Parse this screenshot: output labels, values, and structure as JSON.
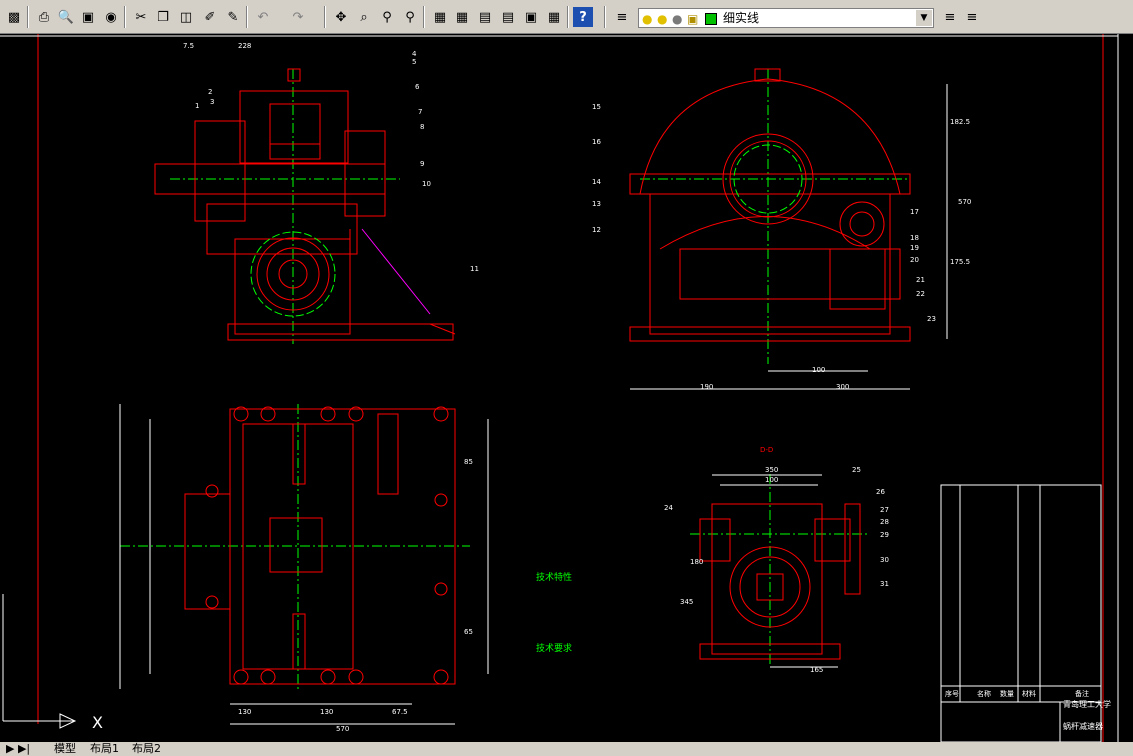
{
  "toolbar": {
    "layer_name": "细实线",
    "icons": [
      "save-icon",
      "print-icon",
      "preview-icon",
      "publish-icon",
      "globe-icon",
      "cut-icon",
      "copy-icon",
      "paste-icon",
      "brush-icon",
      "match-properties-icon",
      "undo-icon",
      "redo-icon",
      "pan-icon",
      "zoom-realtime-icon",
      "zoom-window-icon",
      "zoom-previous-icon",
      "properties-icon",
      "design-center-icon",
      "tool-palettes-icon",
      "sheetset-icon",
      "markup-icon",
      "calculator-icon",
      "help-icon",
      "layer-manager-icon",
      "lightbulb-icon",
      "sun-icon",
      "freeze-icon",
      "lock-icon",
      "color-swatch-icon",
      "make-current-icon",
      "layer-previous-icon"
    ]
  },
  "tabs": [
    "模型",
    "布局1",
    "布局2"
  ],
  "drawing": {
    "side_view_labels": [
      "1",
      "2",
      "3",
      "4",
      "5",
      "6",
      "7",
      "8",
      "9",
      "10",
      "11"
    ],
    "side_view_dims": [
      "7.5",
      "228"
    ],
    "front_view_labels": [
      "15",
      "16",
      "14",
      "13",
      "12",
      "17",
      "18",
      "19",
      "20",
      "21",
      "22",
      "23"
    ],
    "front_view_dims": [
      "182.5",
      "570",
      "175.5",
      "100",
      "190",
      "300"
    ],
    "top_view_dims": [
      "570",
      "130",
      "130",
      "67.5",
      "85",
      "65"
    ],
    "section_title": "D-D",
    "section_dims": [
      "350",
      "100",
      "165",
      "180",
      "345"
    ],
    "section_labels": [
      "24",
      "25",
      "26",
      "27",
      "28",
      "29",
      "30",
      "31"
    ],
    "tech_specs_title": "技术特性",
    "tech_req_title": "技术要求",
    "university": "青岛理工大学",
    "drawing_name": "蜗杆减速器",
    "table_headers": [
      "序号",
      "名称",
      "数量",
      "材料",
      "备注"
    ]
  },
  "colors": {
    "background": "#000000",
    "outline": "#ff0000",
    "centerline": "#00ff00",
    "hatch": "#ff0000",
    "dimension": "#ffffff",
    "phantom": "#ff00ff"
  }
}
